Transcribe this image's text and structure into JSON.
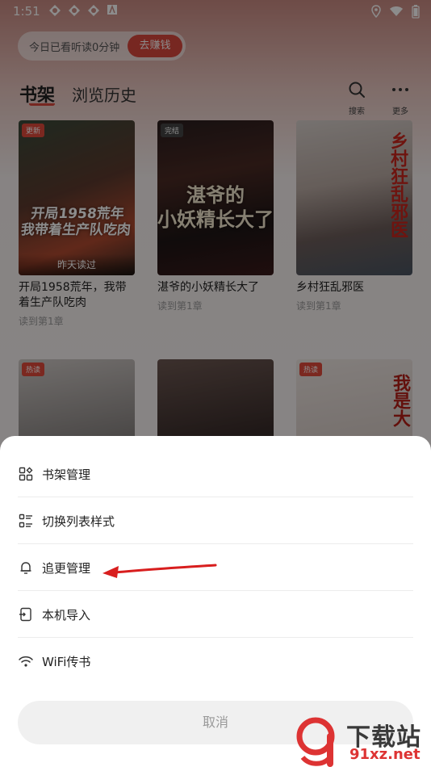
{
  "status_bar": {
    "time": "1:51"
  },
  "reward": {
    "text": "今日已看听读0分钟",
    "button": "去赚钱"
  },
  "tabs": {
    "active": "书架",
    "inactive": "浏览历史"
  },
  "header": {
    "search_label": "搜索",
    "more_label": "更多"
  },
  "books": [
    {
      "badge": "更新",
      "cover_title": "开局1958荒年\n我带着生产队吃肉",
      "overlay": "昨天读过",
      "title": "开局1958荒年，我带着生产队吃肉",
      "progress": "读到第1章",
      "badge_color": "#e0493b"
    },
    {
      "badge": "完结",
      "cover_title": "湛爷的\n小妖精长大了",
      "overlay": "",
      "title": "湛爷的小妖精长大了",
      "progress": "读到第1章",
      "badge_color": "#444444"
    },
    {
      "badge": "",
      "cover_title": "乡村狂乱邪医",
      "overlay": "",
      "title": "乡村狂乱邪医",
      "progress": "读到第1章",
      "badge_color": ""
    },
    {
      "badge": "热读",
      "cover_title": "",
      "overlay": "",
      "title": "",
      "progress": "",
      "badge_color": "#e0493b"
    },
    {
      "badge": "",
      "cover_title": "",
      "overlay": "",
      "title": "",
      "progress": "",
      "badge_color": ""
    },
    {
      "badge": "热读",
      "cover_title": "我是大",
      "overlay": "",
      "title": "",
      "progress": "",
      "badge_color": "#e0493b"
    }
  ],
  "menu": {
    "items": [
      {
        "label": "书架管理",
        "icon": "grid-icon"
      },
      {
        "label": "切换列表样式",
        "icon": "list-style-icon"
      },
      {
        "label": "追更管理",
        "icon": "bell-icon"
      },
      {
        "label": "本机导入",
        "icon": "import-file-icon"
      },
      {
        "label": "WiFi传书",
        "icon": "wifi-icon"
      }
    ],
    "cancel": "取消"
  },
  "watermark": {
    "text_cn": "下载站",
    "text_url": "91xz.net"
  },
  "colors": {
    "accent": "#d9473c",
    "arrow": "#d81e1e"
  }
}
